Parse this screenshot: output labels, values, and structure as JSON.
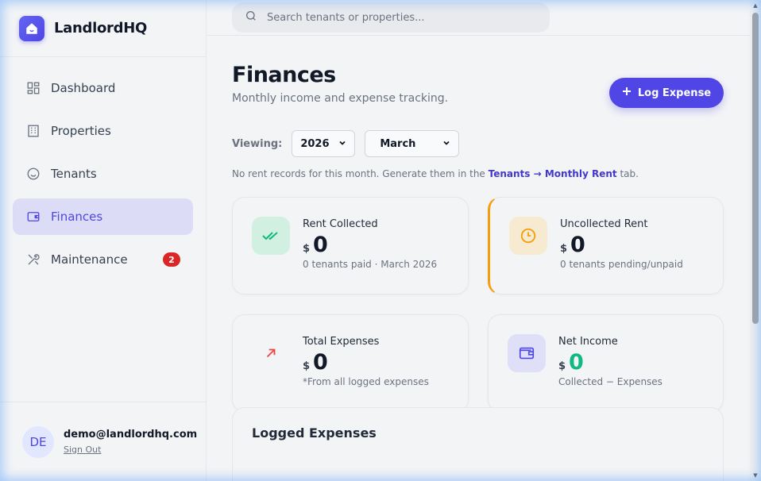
{
  "brand": {
    "name": "LandlordHQ"
  },
  "sidebar": {
    "items": [
      {
        "label": "Dashboard",
        "icon": "grid-icon"
      },
      {
        "label": "Properties",
        "icon": "building-icon"
      },
      {
        "label": "Tenants",
        "icon": "smile-icon"
      },
      {
        "label": "Finances",
        "icon": "wallet-icon",
        "active": true
      },
      {
        "label": "Maintenance",
        "icon": "tools-icon",
        "badge": "2"
      }
    ]
  },
  "user": {
    "initials": "DE",
    "email": "demo@landlordhq.com",
    "signout": "Sign Out"
  },
  "search": {
    "placeholder": "Search tenants or properties..."
  },
  "page": {
    "title": "Finances",
    "subtitle": "Monthly income and expense tracking.",
    "log_button": "Log Expense",
    "viewing_label": "Viewing:",
    "year": "2026",
    "month": "March",
    "notice_pre": "No rent records for this month. Generate them in the ",
    "notice_link": "Tenants → Monthly Rent",
    "notice_post": " tab."
  },
  "cards": [
    {
      "label": "Rent Collected",
      "currency": "$",
      "value": "0",
      "note": "0 tenants paid · March 2026",
      "icon": "double-check-icon",
      "color": "#10b981"
    },
    {
      "label": "Uncollected Rent",
      "currency": "$",
      "value": "0",
      "note": "0 tenants pending/unpaid",
      "icon": "clock-icon",
      "color": "#f59e0b"
    },
    {
      "label": "Total Expenses",
      "currency": "$",
      "value": "0",
      "note": "*From all logged expenses",
      "icon": "arrow-up-right-icon",
      "color": "#ef4444"
    },
    {
      "label": "Net Income",
      "currency": "$",
      "value": "0",
      "note": "Collected − Expenses",
      "icon": "wallet-icon",
      "color": "#4f46e5"
    }
  ],
  "expenses": {
    "title": "Logged Expenses"
  },
  "colors": {
    "accent": "#4f46e5",
    "success": "#10b981",
    "warning": "#f59e0b",
    "danger": "#dc2626"
  }
}
